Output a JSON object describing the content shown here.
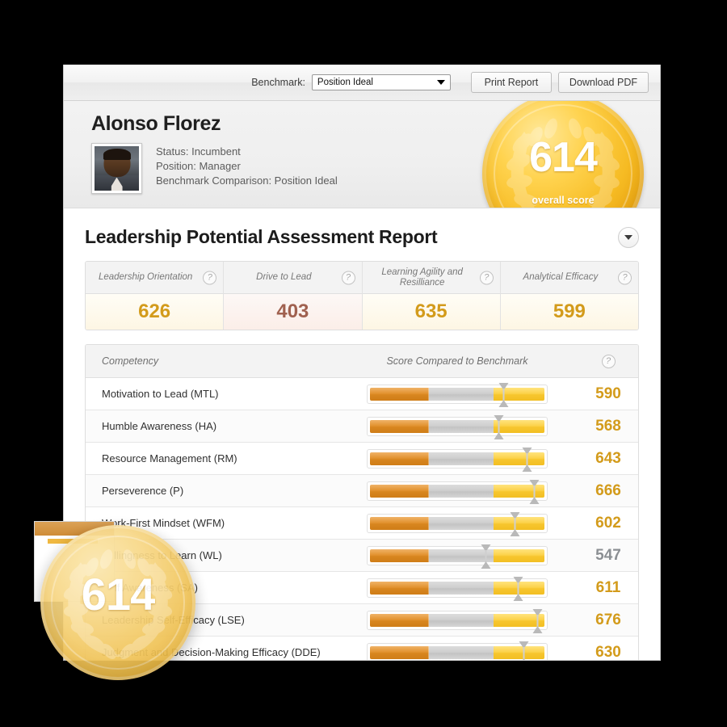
{
  "toolbar": {
    "benchmark_label": "Benchmark:",
    "benchmark_value": "Position Ideal",
    "print_label": "Print Report",
    "download_label": "Download PDF"
  },
  "profile": {
    "name": "Alonso Florez",
    "status": "Status: Incumbent",
    "position": "Position: Manager",
    "benchmark_comparison": "Benchmark Comparison: Position Ideal"
  },
  "medal": {
    "score": "614",
    "caption": "overall score"
  },
  "report": {
    "title": "Leadership Potential Assessment Report"
  },
  "categories": [
    {
      "label": "Leadership Orientation",
      "value": "626",
      "tone": "gold",
      "help": "?"
    },
    {
      "label": "Drive to Lead",
      "value": "403",
      "tone": "low",
      "help": "?"
    },
    {
      "label": "Learning Agility and Resilliance",
      "value": "635",
      "tone": "gold",
      "help": "?"
    },
    {
      "label": "Analytical Efficacy",
      "value": "599",
      "tone": "gold",
      "help": "?"
    }
  ],
  "table": {
    "col_competency": "Competency",
    "col_score": "Score Compared to Benchmark",
    "help": "?"
  },
  "rows": [
    {
      "label": "Motivation to Lead (MTL)",
      "score": "590",
      "tone": "gold",
      "marker": 76
    },
    {
      "label": "Humble Awareness (HA)",
      "score": "568",
      "tone": "gold",
      "marker": 73
    },
    {
      "label": "Resource Management (RM)",
      "score": "643",
      "tone": "gold",
      "marker": 89
    },
    {
      "label": "Perseverence (P)",
      "score": "666",
      "tone": "gold",
      "marker": 93
    },
    {
      "label": "Work-First Mindset (WFM)",
      "score": "602",
      "tone": "gold",
      "marker": 82
    },
    {
      "label": "Willingness to Learn (WL)",
      "score": "547",
      "tone": "gray",
      "marker": 66
    },
    {
      "label": "Self Awareness (SA)",
      "score": "611",
      "tone": "gold",
      "marker": 84
    },
    {
      "label": "Leadership Self-Efficacy (LSE)",
      "score": "676",
      "tone": "gold",
      "marker": 95
    },
    {
      "label": "Judgment and Decision-Making Efficacy (DDE)",
      "score": "630",
      "tone": "gold",
      "marker": 87
    }
  ],
  "colors": {
    "gold": "#d39b1b",
    "low": "#a0614f",
    "gray": "#8b8f93",
    "orange_segment": "#d8861f",
    "yellow_segment": "#f7c62e",
    "gray_segment": "#c3c3c3"
  }
}
